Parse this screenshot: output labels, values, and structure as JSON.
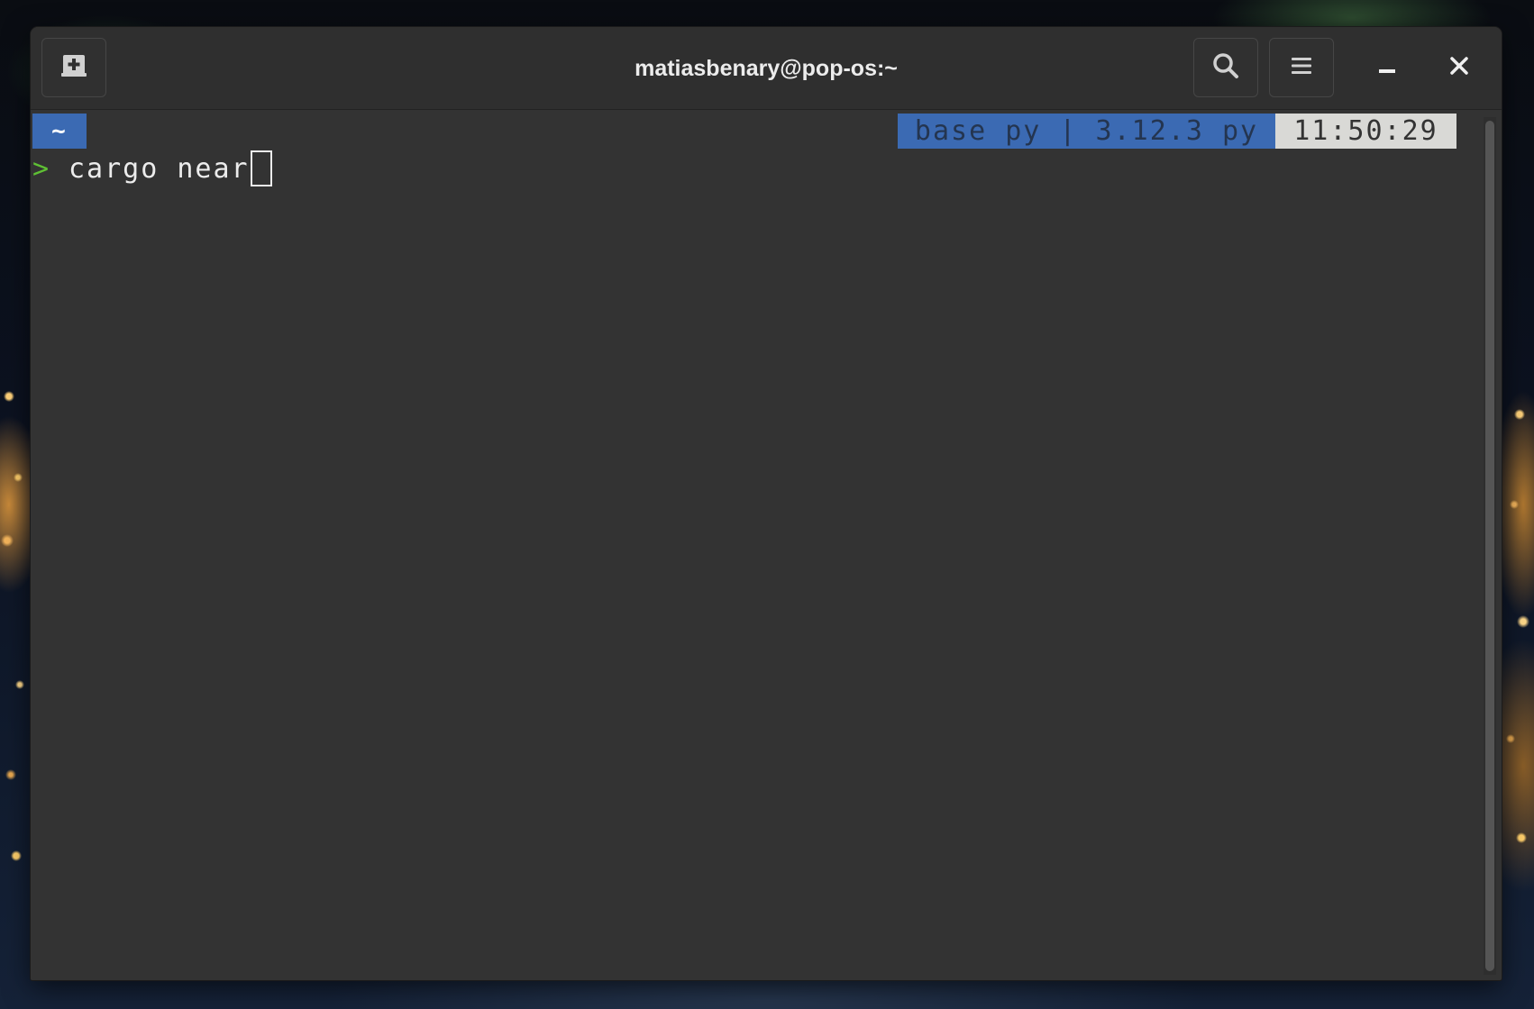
{
  "window": {
    "title": "matiasbenary@pop-os:~"
  },
  "titlebar": {
    "new_tab_icon": "new-tab-icon",
    "search_icon": "search-icon",
    "menu_icon": "hamburger-menu-icon",
    "minimize_icon": "minimize-icon",
    "close_icon": "close-icon"
  },
  "terminal": {
    "prompt_dir": "~",
    "env_segment": "base py | 3.12.3 py",
    "time_segment": "11:50:29",
    "prompt_symbol": ">",
    "command_text": "cargo near"
  },
  "colors": {
    "window_bg": "#333333",
    "titlebar_bg": "#2f2f2f",
    "accent_blue": "#3b6ab3",
    "prompt_green": "#5fc034",
    "time_bg": "#d9d9d6"
  }
}
